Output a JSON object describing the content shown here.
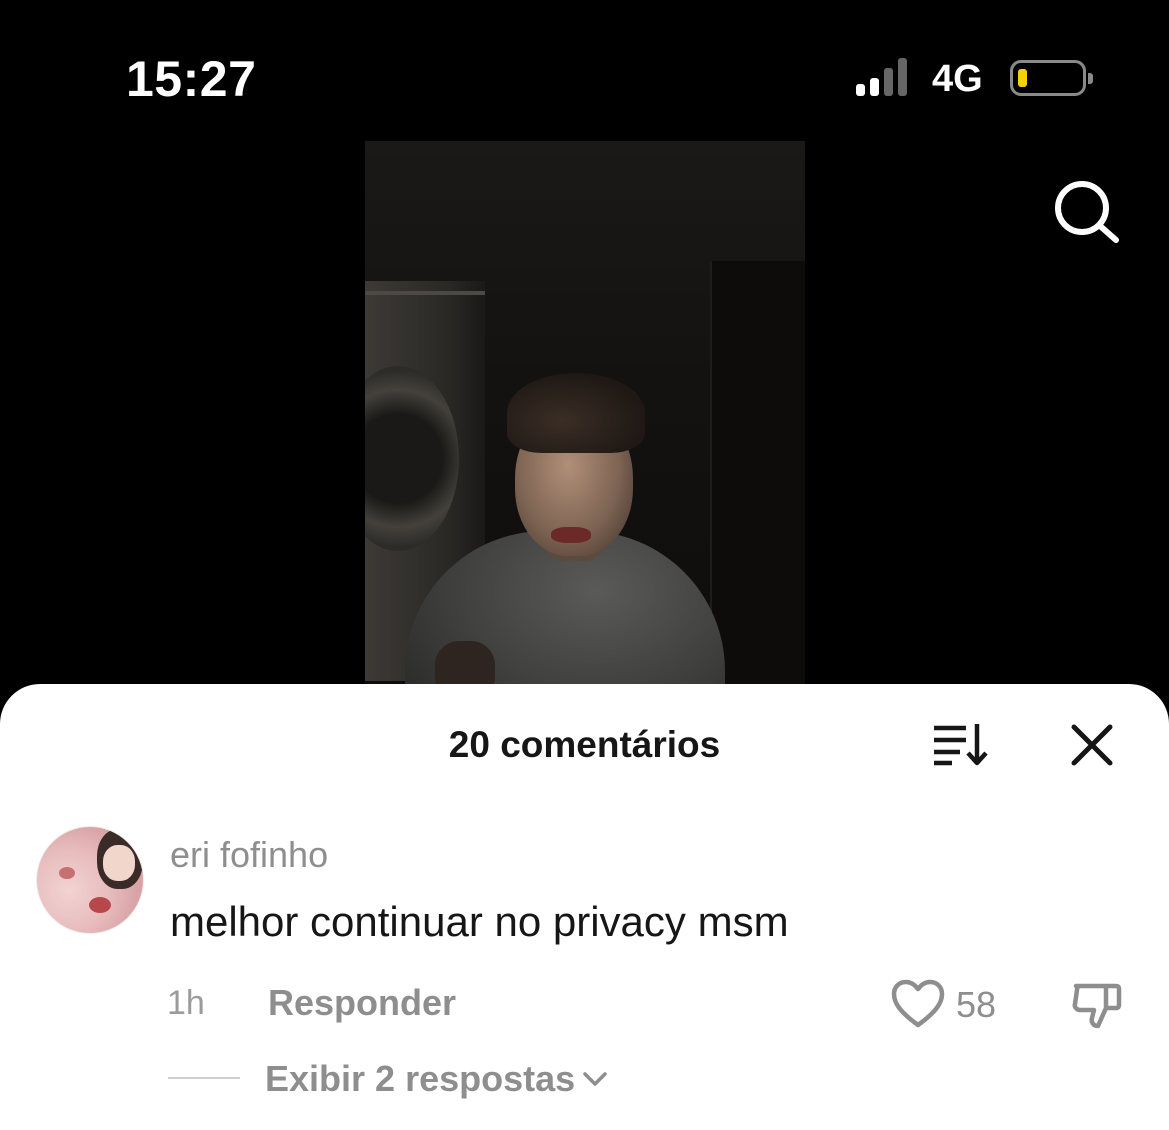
{
  "status_bar": {
    "time": "15:27",
    "network": "4G"
  },
  "comments_sheet": {
    "title": "20 comentários",
    "comments": [
      {
        "username": "eri fofinho",
        "text": "melhor continuar no privacy msm",
        "time": "1h",
        "reply_label": "Responder",
        "likes": "58",
        "view_replies_label": "Exibir 2 respostas"
      }
    ]
  },
  "colors": {
    "battery_low": "#f4d20a",
    "muted_text": "#8e8e8e",
    "sheet_bg": "#ffffff"
  },
  "icons": [
    "search-icon",
    "sort-icon",
    "close-icon",
    "heart-icon",
    "dislike-icon",
    "chevron-down-icon"
  ]
}
